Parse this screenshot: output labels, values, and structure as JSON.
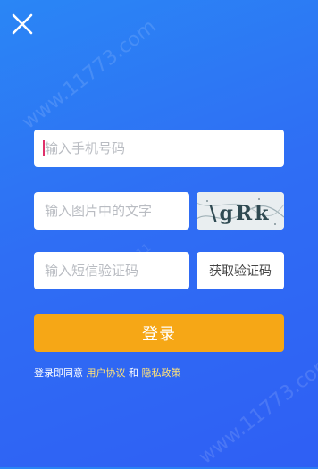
{
  "watermark": {
    "text": "www.11773.com",
    "partial": "11"
  },
  "form": {
    "phone_placeholder": "输入手机号码",
    "image_code_placeholder": "输入图片中的文字",
    "captcha_text": "\\gRk",
    "sms_code_placeholder": "输入短信验证码",
    "get_code_label": "获取验证码",
    "login_label": "登录"
  },
  "agreement": {
    "prefix": "登录即同意",
    "user_agreement": "用户协议",
    "and": "和",
    "privacy_policy": "隐私政策"
  },
  "colors": {
    "background_top": "#2a86f5",
    "background_bottom": "#2f5ff4",
    "login_button": "#f6a716",
    "link": "#ffe27a",
    "caret": "#e0306a"
  },
  "icons": {
    "close": "close-icon"
  }
}
